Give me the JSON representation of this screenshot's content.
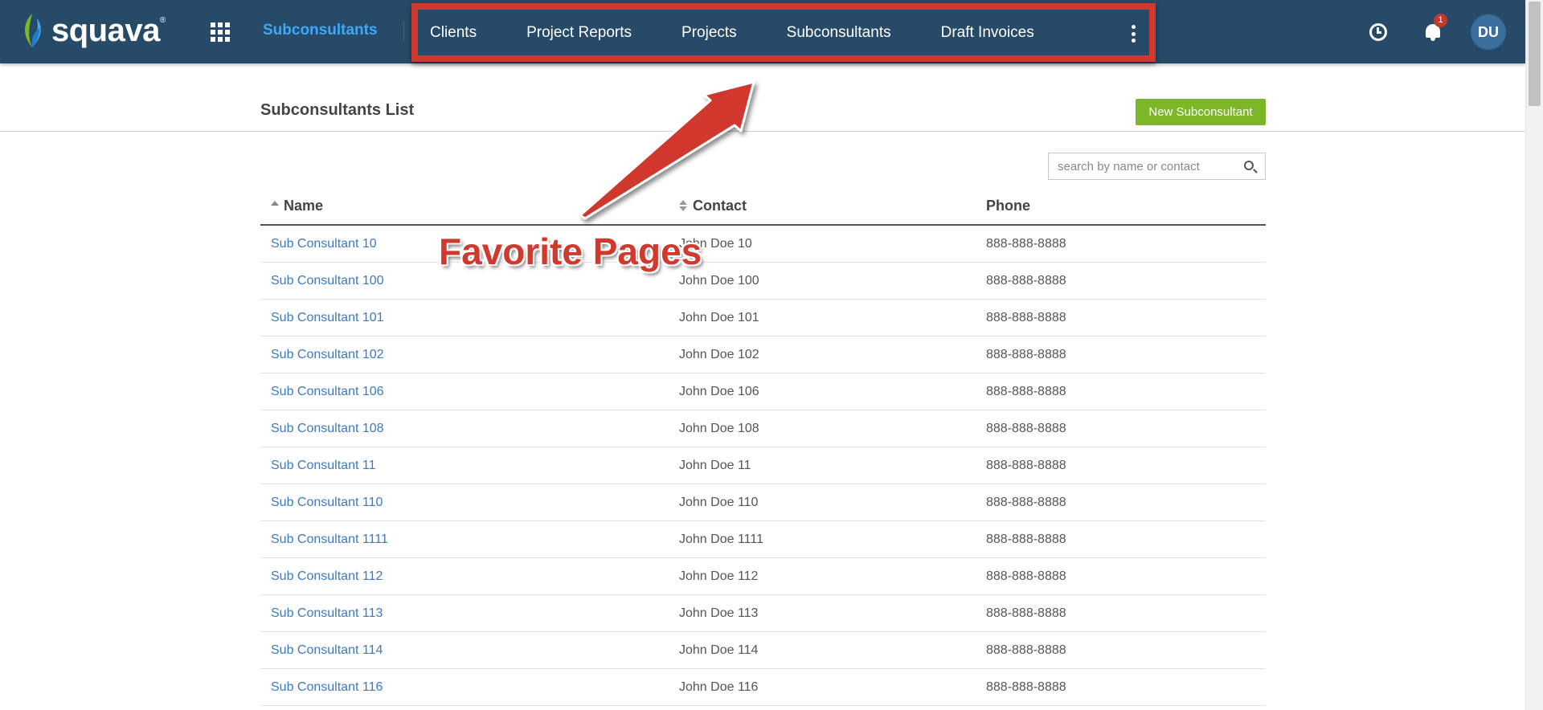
{
  "app": {
    "logo_text": "squava",
    "logo_mark": "®",
    "brand_color": "#264a68",
    "accent_color": "#3fa9f5"
  },
  "header": {
    "apps_icon": "grid-icon",
    "current_page": "Subconsultants",
    "favorites": [
      "Clients",
      "Project Reports",
      "Projects",
      "Subconsultants",
      "Draft Invoices"
    ],
    "more_icon": "vertical-ellipsis-icon",
    "clock_icon": "clock-icon",
    "bell_icon": "bell-icon",
    "notification_count": "1",
    "avatar_initials": "DU"
  },
  "page": {
    "title": "Subconsultants List",
    "new_button": "New Subconsultant",
    "button_color": "#7cb728"
  },
  "search": {
    "placeholder": "search by name or contact",
    "value": ""
  },
  "table": {
    "columns": [
      "Name",
      "Contact",
      "Phone"
    ],
    "rows": [
      [
        "Sub Consultant 10",
        "John Doe 10",
        "888-888-8888"
      ],
      [
        "Sub Consultant 100",
        "John Doe 100",
        "888-888-8888"
      ],
      [
        "Sub Consultant 101",
        "John Doe 101",
        "888-888-8888"
      ],
      [
        "Sub Consultant 102",
        "John Doe 102",
        "888-888-8888"
      ],
      [
        "Sub Consultant 106",
        "John Doe 106",
        "888-888-8888"
      ],
      [
        "Sub Consultant 108",
        "John Doe 108",
        "888-888-8888"
      ],
      [
        "Sub Consultant 11",
        "John Doe 11",
        "888-888-8888"
      ],
      [
        "Sub Consultant 110",
        "John Doe 110",
        "888-888-8888"
      ],
      [
        "Sub Consultant 1111",
        "John Doe 1111",
        "888-888-8888"
      ],
      [
        "Sub Consultant 112",
        "John Doe 112",
        "888-888-8888"
      ],
      [
        "Sub Consultant 113",
        "John Doe 113",
        "888-888-8888"
      ],
      [
        "Sub Consultant 114",
        "John Doe 114",
        "888-888-8888"
      ],
      [
        "Sub Consultant 116",
        "John Doe 116",
        "888-888-8888"
      ]
    ]
  },
  "annotation": {
    "label": "Favorite Pages",
    "color": "#d0392d"
  }
}
